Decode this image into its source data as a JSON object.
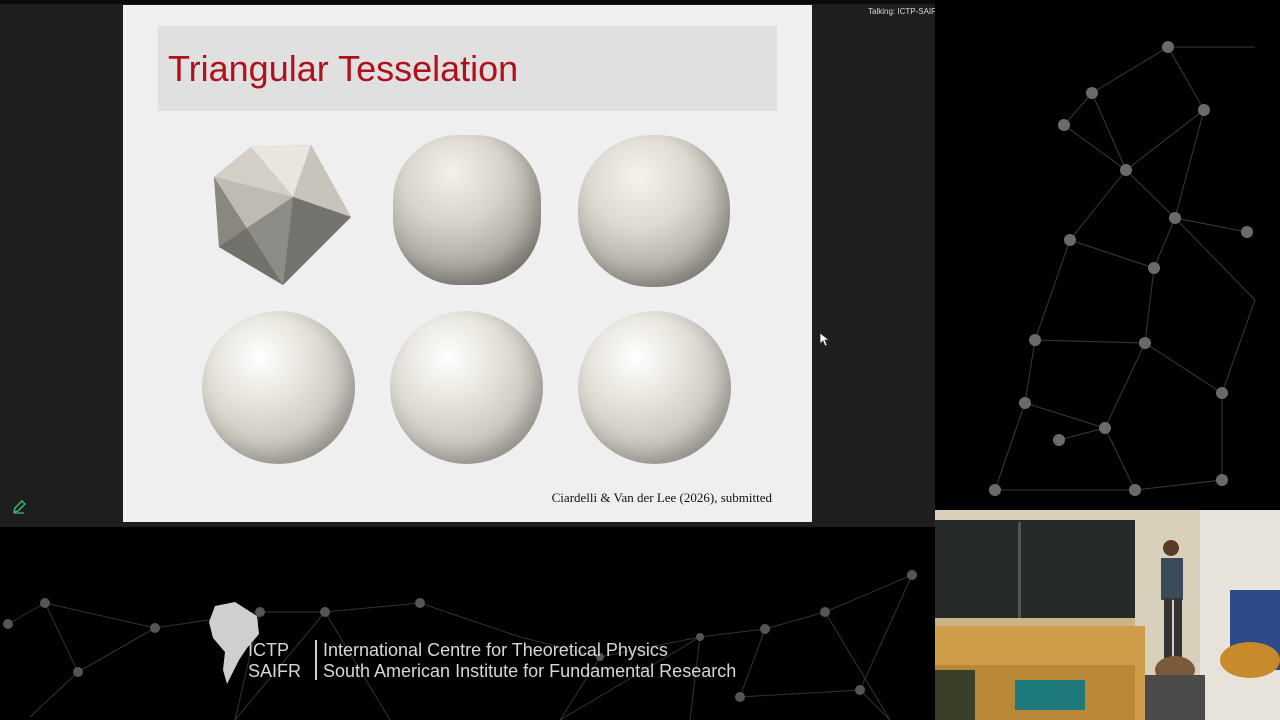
{
  "slide": {
    "title": "Triangular Tesselation",
    "citation": "Ciardelli & Van der Lee (2026), submitted"
  },
  "status": {
    "talking": "Talking: ICTP-SAIFR"
  },
  "branding": {
    "acronym_1": "ICTP",
    "acronym_2": "SAIFR",
    "line_1": "International Centre for Theoretical Physics",
    "line_2": "South American Institute for Fundamental Research"
  },
  "icons": {
    "edit": "pencil-icon",
    "cursor": "mouse-pointer-icon",
    "map": "south-america-map-icon"
  },
  "colors": {
    "title_red": "#b0101a",
    "slide_bg": "#efefef",
    "title_bar": "#e0e0e0"
  }
}
